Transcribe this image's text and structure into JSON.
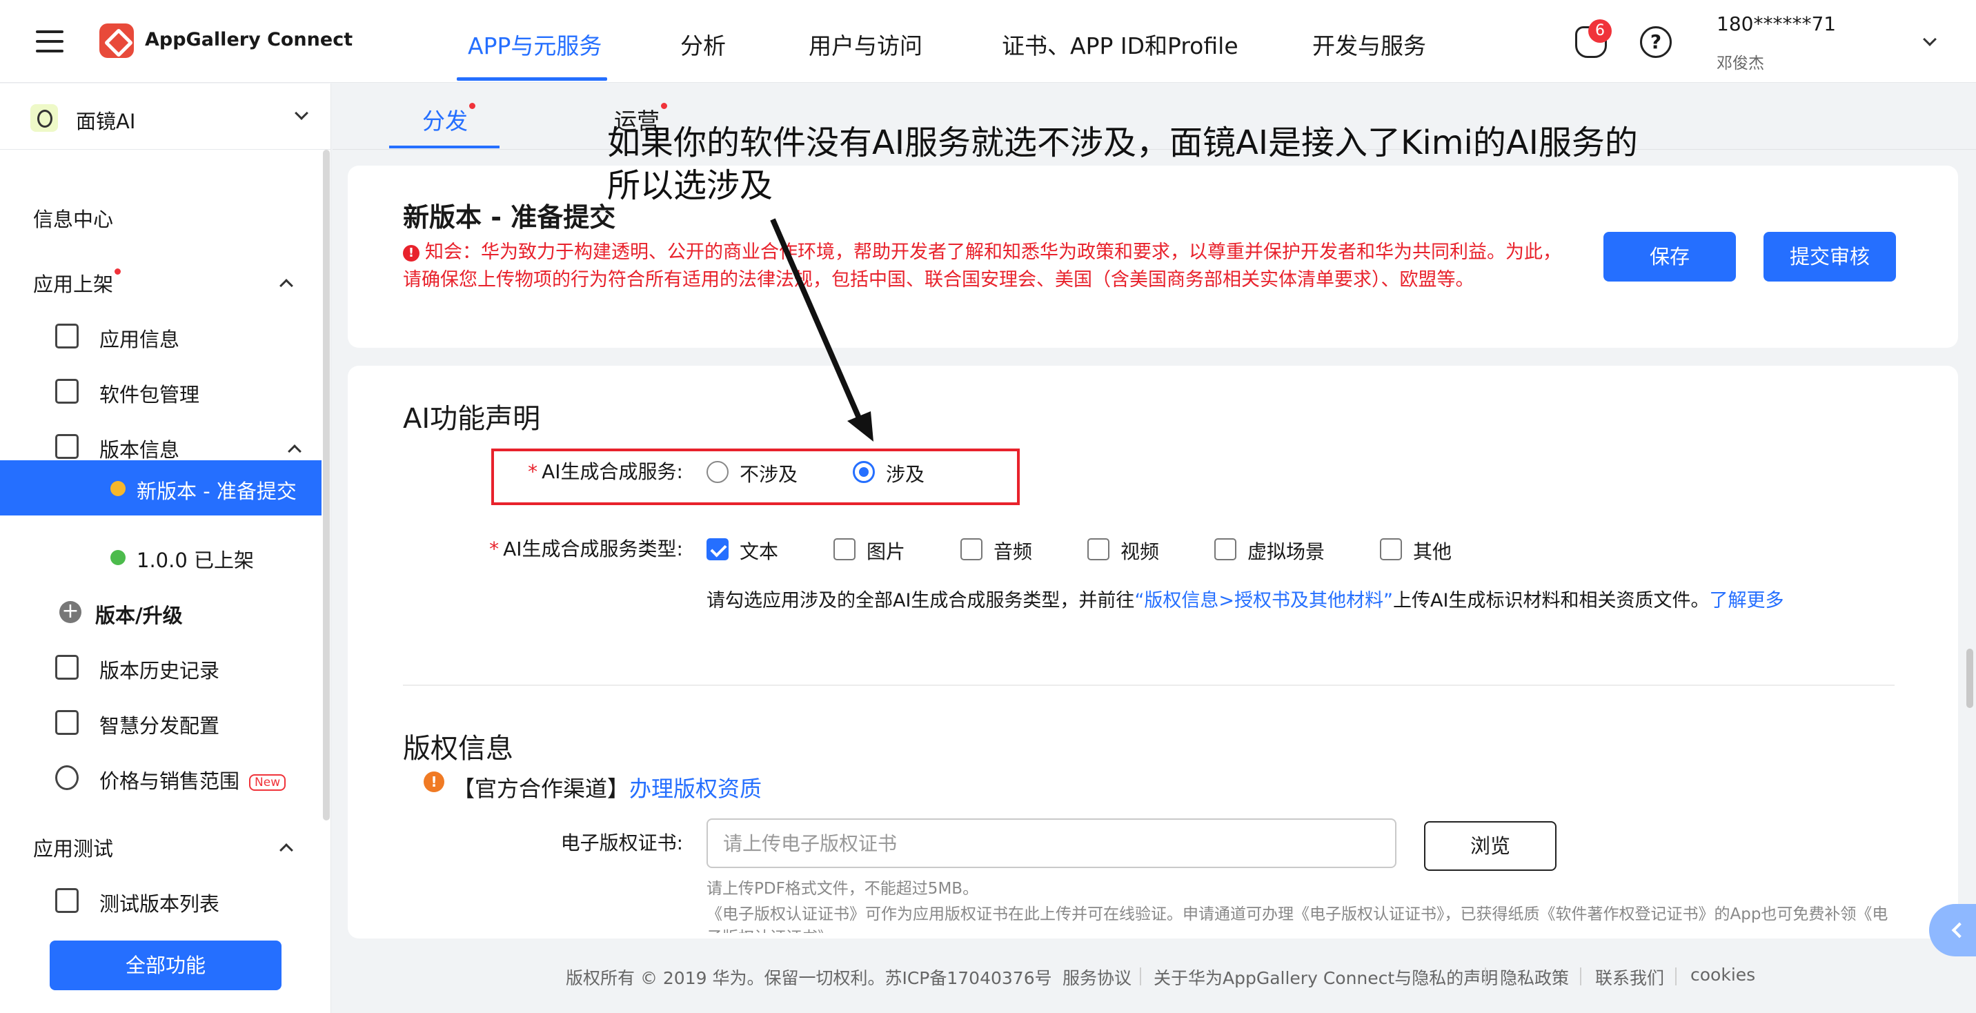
{
  "topbar": {
    "brand": "AppGallery Connect",
    "nav": [
      "APP与元服务",
      "分析",
      "用户与访问",
      "证书、APP ID和Profile",
      "开发与服务"
    ],
    "notification_count": "6",
    "help_symbol": "?",
    "user_phone": "180******71",
    "user_name": "邓俊杰"
  },
  "sidebar": {
    "app_name": "面镜AI",
    "items": {
      "info_center": "信息中心",
      "app_listing": "应用上架",
      "app_info": "应用信息",
      "package_mgmt": "软件包管理",
      "version_info": "版本信息",
      "new_version": "新版本 - 准备提交",
      "released_version": "1.0.0 已上架",
      "version_upgrade": "版本/升级",
      "version_history": "版本历史记录",
      "smart_distribution": "智慧分发配置",
      "price_sales": "价格与销售范围",
      "new_tag": "New",
      "app_testing": "应用测试",
      "test_version_list": "测试版本列表"
    },
    "all_functions": "全部功能"
  },
  "subtabs": [
    "分发",
    "运营"
  ],
  "page": {
    "title": "新版本 - 准备提交",
    "notice": "知会：华为致力于构建透明、公开的商业合作环境，帮助开发者了解和知悉华为政策和要求，以尊重并保护开发者和华为共同利益。为此，请确保您上传物项的行为符合所有适用的法律法规，包括中国、联合国安理会、美国（含美国商务部相关实体清单要求）、欧盟等。",
    "notice_icon": "!",
    "save": "保存",
    "submit": "提交审核"
  },
  "ai_section": {
    "title": "AI功能声明",
    "service_label": "AI生成合成服务:",
    "options": [
      "不涉及",
      "涉及"
    ],
    "selected": "涉及",
    "type_label": "AI生成合成服务类型:",
    "types": [
      "文本",
      "图片",
      "音频",
      "视频",
      "虚拟场景",
      "其他"
    ],
    "checked_types": [
      "文本"
    ],
    "hint_prefix": "请勾选应用涉及的全部AI生成合成服务类型，并前往",
    "hint_link": "“版权信息>授权书及其他材料”",
    "hint_suffix": "上传AI生成标识材料和相关资质文件。",
    "learn_more": "了解更多"
  },
  "copyright_section": {
    "title": "版权信息",
    "warn_icon": "!",
    "channel_prefix": "【官方合作渠道】",
    "channel_link": "办理版权资质",
    "cert_label": "电子版权证书:",
    "cert_placeholder": "请上传电子版权证书",
    "browse": "浏览",
    "hint1": "请上传PDF格式文件，不能超过5MB。",
    "hint2": "《电子版权认证证书》可作为应用版权证书在此上传并可在线验证。申请通道可办理《电子版权认证证书》，已获得纸质《软件著作权登记证书》的App也可免费补领《电子版权认证证书》。"
  },
  "annotation": {
    "line1": "如果你的软件没有AI服务就选不涉及，面镜AI是接入了Kimi的AI服务的",
    "line2": "所以选涉及",
    "color": "#e8222c"
  },
  "footer": {
    "copyright": "版权所有 © 2019 华为。保留一切权利。苏ICP备17040376号",
    "links": [
      "服务协议",
      "关于华为AppGallery Connect与隐私的声明",
      "隐私政策",
      "联系我们",
      "cookies"
    ]
  },
  "colors": {
    "accent": "#256fff",
    "danger": "#e8222c",
    "warning": "#f07a24",
    "success": "#4cbb4c",
    "pending": "#f6b72b"
  }
}
